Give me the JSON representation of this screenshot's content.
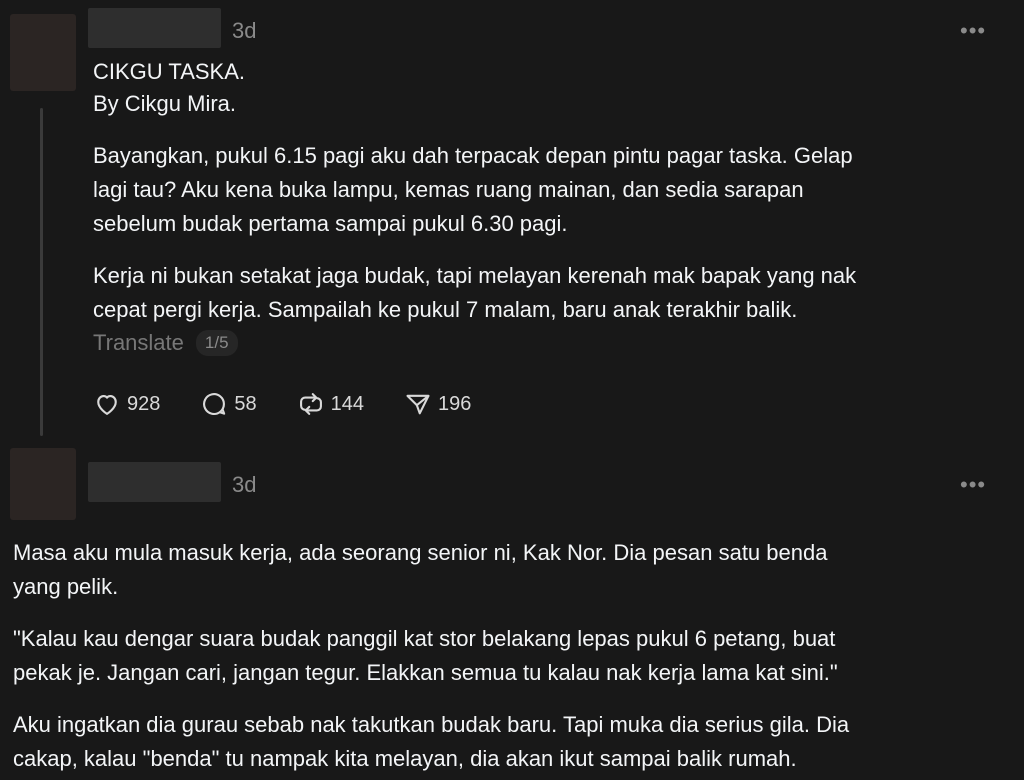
{
  "post1": {
    "time": "3d",
    "more": "•••",
    "lines": [
      "CIKGU TASKA.",
      "By Cikgu Mira."
    ],
    "para1": [
      "Bayangkan, pukul 6.15 pagi aku dah terpacak depan pintu pagar taska. Gelap",
      "lagi tau? Aku kena buka lampu, kemas ruang mainan, dan sedia sarapan",
      "sebelum budak pertama sampai pukul 6.30 pagi."
    ],
    "para2": [
      "Kerja ni bukan setakat jaga budak, tapi melayan kerenah mak bapak yang nak",
      "cepat pergi kerja. Sampailah ke pukul 7 malam, baru anak terakhir balik."
    ],
    "translate": "Translate",
    "page_indicator": "1/5",
    "likes": "928",
    "replies": "58",
    "reposts": "144",
    "shares": "196"
  },
  "post2": {
    "time": "3d",
    "more": "•••",
    "para1": [
      "Masa aku mula masuk kerja, ada seorang senior ni, Kak Nor. Dia pesan satu benda",
      "yang pelik."
    ],
    "para2": [
      "\"Kalau kau dengar suara budak panggil kat stor belakang lepas pukul 6 petang, buat",
      "pekak je. Jangan cari, jangan tegur. Elakkan semua tu kalau nak kerja lama kat sini.\""
    ],
    "para3": [
      "Aku ingatkan dia gurau sebab nak takutkan budak baru. Tapi muka dia serius gila. Dia",
      "cakap, kalau \"benda\" tu nampak kita melayan, dia akan ikut sampai balik rumah."
    ]
  }
}
